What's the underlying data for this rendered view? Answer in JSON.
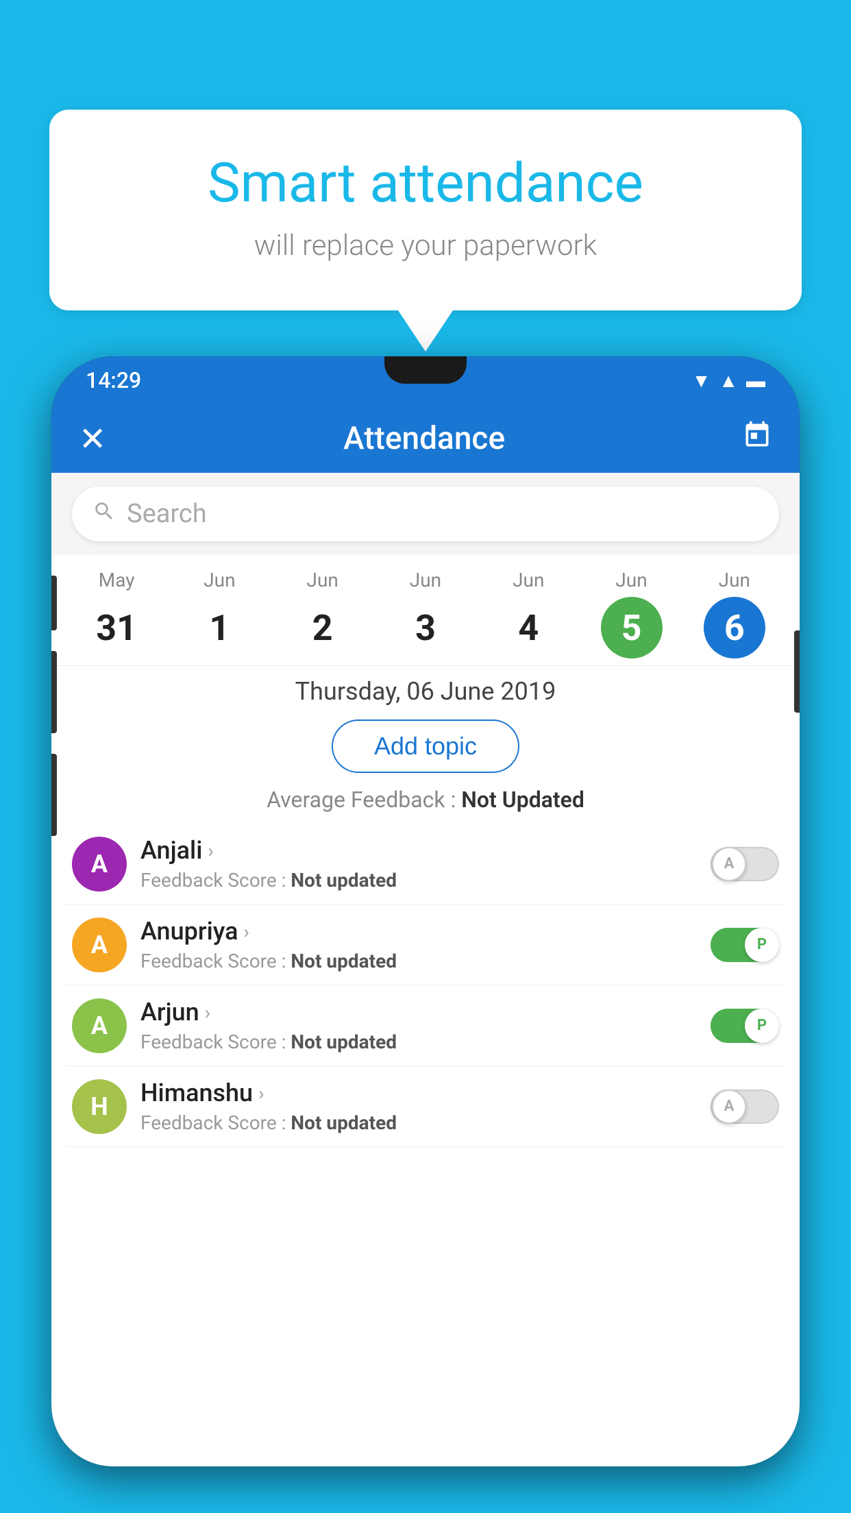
{
  "background_color": "#1ab8e8",
  "speech_bubble": {
    "title": "Smart attendance",
    "subtitle": "will replace your paperwork"
  },
  "status_bar": {
    "time": "14:29",
    "icons": [
      "wifi",
      "signal",
      "battery"
    ]
  },
  "app_header": {
    "close_label": "×",
    "title": "Attendance",
    "calendar_icon": "📅"
  },
  "search": {
    "placeholder": "Search"
  },
  "calendar": {
    "days": [
      {
        "month": "May",
        "date": "31",
        "state": "normal"
      },
      {
        "month": "Jun",
        "date": "1",
        "state": "normal"
      },
      {
        "month": "Jun",
        "date": "2",
        "state": "normal"
      },
      {
        "month": "Jun",
        "date": "3",
        "state": "normal"
      },
      {
        "month": "Jun",
        "date": "4",
        "state": "normal"
      },
      {
        "month": "Jun",
        "date": "5",
        "state": "today"
      },
      {
        "month": "Jun",
        "date": "6",
        "state": "selected"
      }
    ]
  },
  "selected_date": "Thursday, 06 June 2019",
  "add_topic_label": "Add topic",
  "average_feedback": {
    "label": "Average Feedback : ",
    "value": "Not Updated"
  },
  "students": [
    {
      "name": "Anjali",
      "avatar_letter": "A",
      "avatar_color": "purple",
      "feedback_label": "Feedback Score : ",
      "feedback_value": "Not updated",
      "toggle_state": "off",
      "toggle_letter": "A"
    },
    {
      "name": "Anupriya",
      "avatar_letter": "A",
      "avatar_color": "yellow",
      "feedback_label": "Feedback Score : ",
      "feedback_value": "Not updated",
      "toggle_state": "on",
      "toggle_letter": "P"
    },
    {
      "name": "Arjun",
      "avatar_letter": "A",
      "avatar_color": "green",
      "feedback_label": "Feedback Score : ",
      "feedback_value": "Not updated",
      "toggle_state": "on",
      "toggle_letter": "P"
    },
    {
      "name": "Himanshu",
      "avatar_letter": "H",
      "avatar_color": "olive",
      "feedback_label": "Feedback Score : ",
      "feedback_value": "Not updated",
      "toggle_state": "off",
      "toggle_letter": "A"
    }
  ]
}
